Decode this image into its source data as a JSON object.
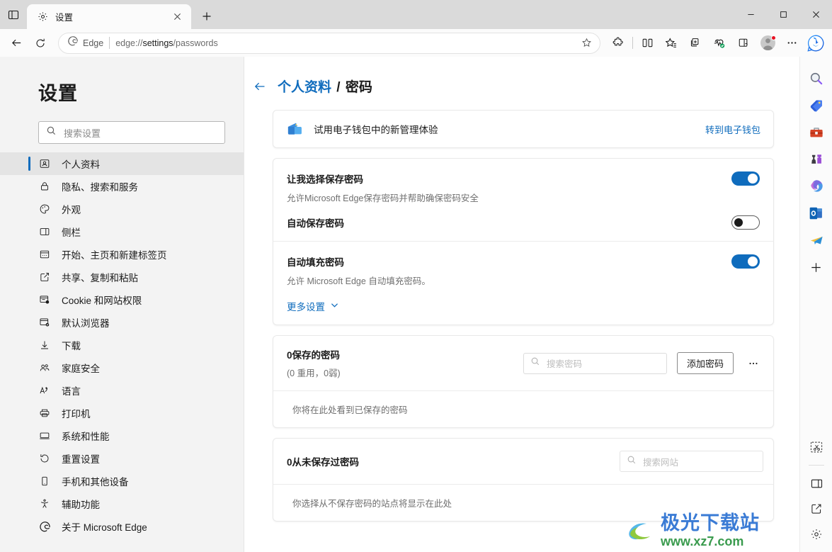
{
  "window": {
    "tab_strip_icon": "tab-list-icon",
    "tabs": [
      {
        "title": "设置",
        "favicon": "gear-icon",
        "close": "close-icon"
      }
    ],
    "new_tab_label": "+",
    "controls": {
      "minimize": "—",
      "maximize": "▢",
      "close": "✕"
    }
  },
  "toolbar": {
    "back": "back-arrow-icon",
    "refresh": "refresh-icon",
    "omnibox": {
      "brand": "Edge",
      "url_prefix": "edge://",
      "url_bold": "settings",
      "url_suffix": "/passwords",
      "full_url": "edge://settings/passwords",
      "favorite": "star-outline-icon"
    },
    "icons": [
      "extensions-icon",
      "split-screen-icon",
      "favorites-icon",
      "collections-icon",
      "browser-essentials-icon",
      "drop-icon"
    ],
    "profile": "avatar",
    "more": "ellipsis-icon",
    "copilot": "bing-copilot-icon"
  },
  "sidebar": {
    "title": "设置",
    "search": {
      "placeholder": "搜索设置",
      "icon": "search-icon"
    },
    "items": [
      {
        "label": "个人资料",
        "icon": "profile-icon",
        "active": true
      },
      {
        "label": "隐私、搜索和服务",
        "icon": "lock-icon",
        "active": false
      },
      {
        "label": "外观",
        "icon": "palette-icon",
        "active": false
      },
      {
        "label": "侧栏",
        "icon": "sidebar-icon",
        "active": false
      },
      {
        "label": "开始、主页和新建标签页",
        "icon": "home-page-icon",
        "active": false
      },
      {
        "label": "共享、复制和粘贴",
        "icon": "share-icon",
        "active": false
      },
      {
        "label": "Cookie 和网站权限",
        "icon": "cookie-permissions-icon",
        "active": false
      },
      {
        "label": "默认浏览器",
        "icon": "default-browser-icon",
        "active": false
      },
      {
        "label": "下载",
        "icon": "download-icon",
        "active": false
      },
      {
        "label": "家庭安全",
        "icon": "family-safety-icon",
        "active": false
      },
      {
        "label": "语言",
        "icon": "language-icon",
        "active": false
      },
      {
        "label": "打印机",
        "icon": "printer-icon",
        "active": false
      },
      {
        "label": "系统和性能",
        "icon": "system-performance-icon",
        "active": false
      },
      {
        "label": "重置设置",
        "icon": "reset-icon",
        "active": false
      },
      {
        "label": "手机和其他设备",
        "icon": "phone-icon",
        "active": false
      },
      {
        "label": "辅助功能",
        "icon": "accessibility-icon",
        "active": false
      },
      {
        "label": "关于 Microsoft Edge",
        "icon": "edge-logo-icon",
        "active": false
      }
    ]
  },
  "main": {
    "back_icon": "back-arrow-icon",
    "breadcrumb": {
      "parent": "个人资料",
      "separator": "/",
      "current": "密码"
    },
    "wallet_banner": {
      "icon": "wallet-icon",
      "text": "试用电子钱包中的新管理体验",
      "link": "转到电子钱包"
    },
    "settings": [
      {
        "title": "让我选择保存密码",
        "desc": "允许Microsoft Edge保存密码并帮助确保密码安全",
        "toggle": "on"
      },
      {
        "title": "自动保存密码",
        "desc": "",
        "toggle": "off"
      },
      {
        "title": "自动填充密码",
        "desc": "允许 Microsoft Edge 自动填充密码。",
        "toggle": "on"
      }
    ],
    "more_settings": {
      "label": "更多设置",
      "icon": "chevron-down-icon"
    },
    "saved_passwords": {
      "count_label": "0保存的密码",
      "sub_label": "(0 重用，0弱)",
      "search_placeholder": "搜索密码",
      "search_icon": "search-icon",
      "add_button": "添加密码",
      "more_icon": "ellipsis-icon",
      "empty_text": "你将在此处看到已保存的密码"
    },
    "never_saved": {
      "count_label": "0从未保存过密码",
      "search_placeholder": "搜索网站",
      "search_icon": "search-icon",
      "empty_text": "你选择从不保存密码的站点将显示在此处"
    }
  },
  "right_rail": {
    "icons": [
      "search-magnifier-icon",
      "shopping-tag-icon",
      "toolbox-icon",
      "games-chess-icon",
      "microsoft-365-icon",
      "outlook-icon",
      "telegram-plane-icon",
      "add-icon"
    ],
    "bottom_icons": [
      "screenshot-capture-icon",
      "sidebar-toggle-icon",
      "open-external-icon",
      "settings-gear-icon"
    ]
  },
  "watermark": {
    "cn": "极光下载站",
    "url": "www.xz7.com"
  },
  "colors": {
    "accent": "#0f6cbd",
    "titlebar_bg": "#dadada",
    "toolbar_bg": "#fbfbfb",
    "nav_bg": "#f3f3f3",
    "nav_active_bg": "#e4e4e4",
    "toggle_on": "#0f6cbd",
    "notification_dot": "#e81123"
  }
}
